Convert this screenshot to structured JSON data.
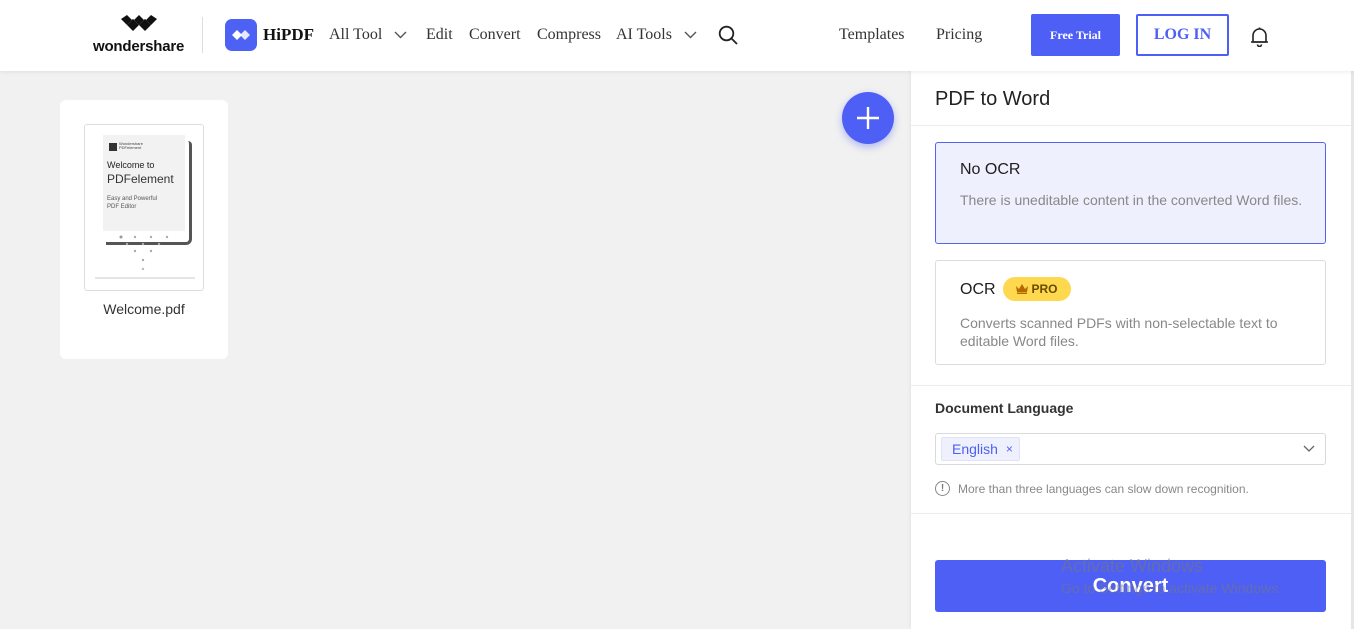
{
  "header": {
    "brand_text": "wondershare",
    "product_name": "HiPDF",
    "nav": {
      "all_tool": "All Tool",
      "edit": "Edit",
      "convert": "Convert",
      "compress": "Compress",
      "ai_tools": "AI Tools",
      "templates": "Templates",
      "pricing": "Pricing"
    },
    "free_trial": "Free Trial",
    "login": "LOG IN",
    "icons": [
      "search-icon",
      "bell-icon",
      "chevron-down-icon"
    ]
  },
  "file": {
    "name": "Welcome.pdf",
    "thumb_welcome": "Welcome to",
    "thumb_title": "PDFelement",
    "thumb_sub_line1": "Easy and Powerful",
    "thumb_sub_line2": "PDF Editor",
    "thumb_brand": "Wondershare PDFelement"
  },
  "panel": {
    "title": "PDF to Word",
    "options": [
      {
        "title": "No OCR",
        "description": "There is uneditable content in the converted Word files.",
        "selected": true
      },
      {
        "title": "OCR",
        "badge": "PRO",
        "description": "Converts scanned PDFs with non-selectable text to editable Word files.",
        "selected": false
      }
    ],
    "language_label": "Document Language",
    "language_selected": "English",
    "language_remove": "×",
    "hint": "More than three languages can slow down recognition.",
    "hint_icon": "!",
    "convert": "Convert"
  },
  "watermark": {
    "line1": "Activate Windows",
    "line2": "Go to Settings to activate Windows."
  },
  "colors": {
    "accent": "#4e5ff5",
    "pro_badge": "#fed84e",
    "selected_bg": "#eff0fd",
    "page_bg": "#f1f1f1"
  }
}
